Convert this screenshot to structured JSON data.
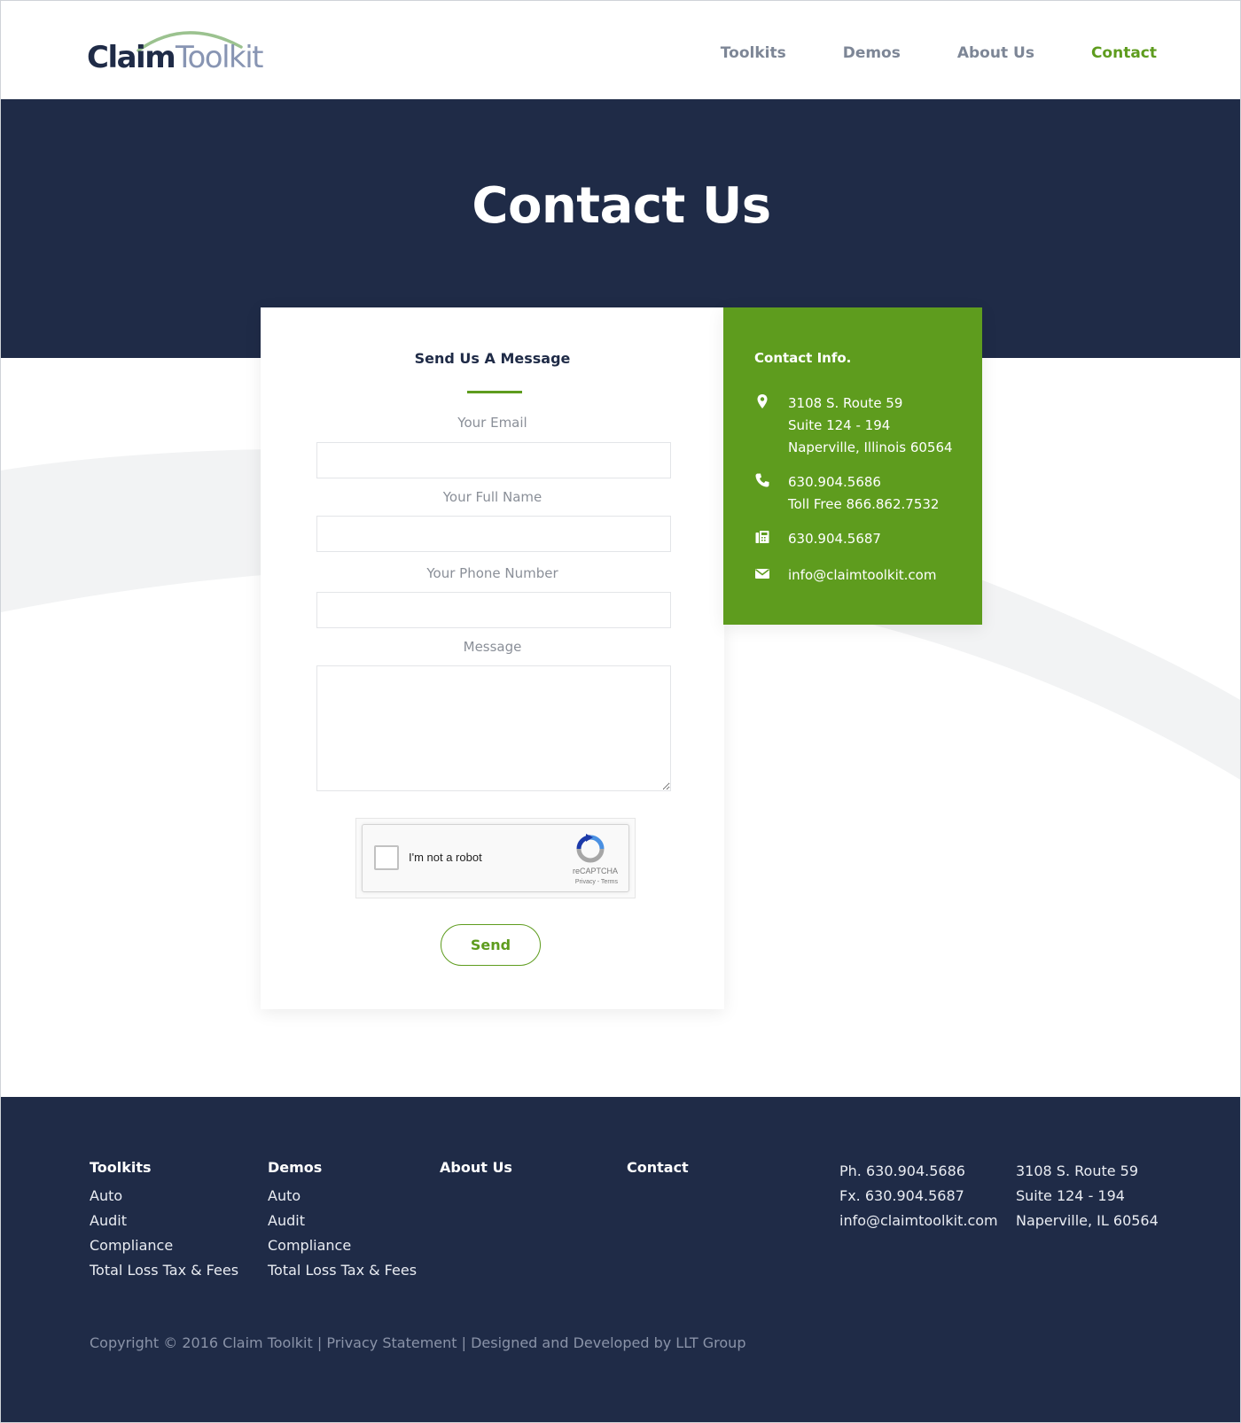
{
  "brand": {
    "logo_part1": "Claim",
    "logo_part2": "Toolkit",
    "logo_color_dark": "#1f2b47",
    "logo_color_light": "#8895b3",
    "arc_color": "#9bc28f"
  },
  "nav": {
    "items": [
      {
        "label": "Toolkits",
        "active": false
      },
      {
        "label": "Demos",
        "active": false
      },
      {
        "label": "About Us",
        "active": false
      },
      {
        "label": "Contact",
        "active": true
      }
    ]
  },
  "hero": {
    "title": "Contact Us"
  },
  "form": {
    "title": "Send Us  A Message",
    "fields": [
      {
        "label": "Your Email",
        "value": ""
      },
      {
        "label": "Your Full Name",
        "value": ""
      },
      {
        "label": "Your Phone Number",
        "value": ""
      },
      {
        "label": "Message",
        "value": ""
      }
    ],
    "captcha": {
      "label": "I'm not a robot",
      "brand": "reCAPTCHA",
      "links": "Privacy - Terms",
      "checked": false
    },
    "submit_label": "Send"
  },
  "contact_info": {
    "title": "Contact Info.",
    "address": [
      "3108 S. Route 59",
      "Suite 124 - 194",
      "Naperville, Illinois 60564"
    ],
    "phone": [
      "630.904.5686",
      "Toll Free 866.862.7532"
    ],
    "fax": "630.904.5687",
    "email": "info@claimtoolkit.com",
    "icons": [
      "map-pin-icon",
      "phone-icon",
      "fax-icon",
      "envelope-icon"
    ]
  },
  "footer": {
    "columns": [
      {
        "heading": "Toolkits",
        "items": [
          "Auto",
          "Audit",
          "Compliance",
          "Total Loss Tax & Fees"
        ]
      },
      {
        "heading": "Demos",
        "items": [
          "Auto",
          "Audit",
          "Compliance",
          "Total Loss Tax & Fees"
        ]
      },
      {
        "heading": "About Us",
        "items": []
      },
      {
        "heading": "Contact",
        "items": []
      }
    ],
    "contact": [
      "Ph. 630.904.5686",
      "Fx. 630.904.5687",
      "info@claimtoolkit.com"
    ],
    "address": [
      "3108 S. Route 59",
      "Suite 124 - 194",
      "Naperville, IL 60564"
    ],
    "copyright": "Copyright © 2016 Claim Toolkit | Privacy Statement | Designed and Developed by LLT Group"
  },
  "colors": {
    "navy": "#1f2b47",
    "green": "#5e9c1e",
    "nav_text": "#7d8696"
  }
}
